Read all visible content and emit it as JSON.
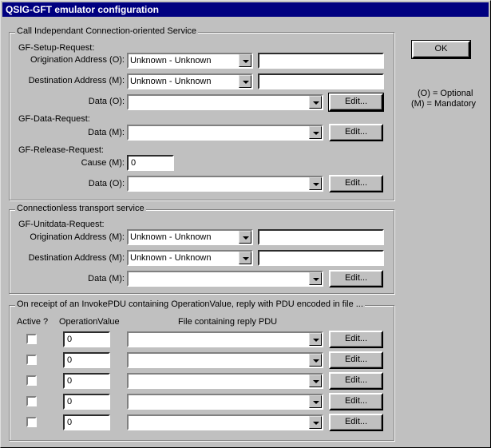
{
  "title": "QSIG-GFT emulator configuration",
  "ok_label": "OK",
  "legend_note": [
    "(O) = Optional",
    "(M) = Mandatory"
  ],
  "edit_label": "Edit...",
  "group1": {
    "title": "Call Independant Connection-oriented Service",
    "setup_title": "GF-Setup-Request:",
    "orig_label": "Origination Address (O):",
    "orig_value": "Unknown - Unknown",
    "dest_label": "Destination Address (M):",
    "dest_value": "Unknown - Unknown",
    "data_o_label": "Data (O):",
    "data_req_title": "GF-Data-Request:",
    "data_m_label": "Data (M):",
    "release_title": "GF-Release-Request:",
    "cause_label": "Cause (M):",
    "cause_value": "0",
    "rel_data_label": "Data (O):"
  },
  "group2": {
    "title": "Connectionless transport service",
    "unidata_title": "GF-Unitdata-Request:",
    "orig_label": "Origination Address (M):",
    "orig_value": "Unknown - Unknown",
    "dest_label": "Destination Address (M):",
    "dest_value": "Unknown - Unknown",
    "data_label": "Data (M):"
  },
  "group3": {
    "title": "On receipt of an InvokePDU containing OperationValue, reply with PDU encoded in file ...",
    "col_active": "Active ?",
    "col_opvalue": "OperationValue",
    "col_file": "File containing reply PDU",
    "rows": [
      {
        "active": false,
        "opvalue": "0",
        "file": ""
      },
      {
        "active": false,
        "opvalue": "0",
        "file": ""
      },
      {
        "active": false,
        "opvalue": "0",
        "file": ""
      },
      {
        "active": false,
        "opvalue": "0",
        "file": ""
      },
      {
        "active": false,
        "opvalue": "0",
        "file": ""
      }
    ]
  }
}
